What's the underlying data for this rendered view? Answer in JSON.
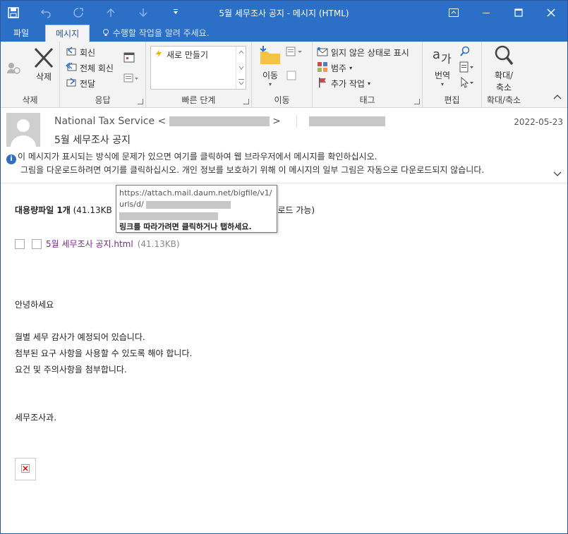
{
  "window": {
    "title": "5월 세무조사 공지 - 메시지 (HTML)"
  },
  "tabs": {
    "file": "파일",
    "message": "메시지",
    "tell_me": "수행할 작업을 알려 주세요."
  },
  "ribbon": {
    "delete_group": {
      "label": "삭제",
      "delete_button": "삭제"
    },
    "respond_group": {
      "label": "응답",
      "reply": "회신",
      "reply_all": "전체 회신",
      "forward": "전달"
    },
    "quick_steps_group": {
      "label": "빠른 단계",
      "new": "새로 만들기"
    },
    "move_group": {
      "label": "이동",
      "move_button": "이동"
    },
    "tags_group": {
      "label": "태그",
      "mark_unread": "읽지 않은 상태로 표시",
      "categorize": "범주",
      "follow_up": "추가 작업"
    },
    "editing_group": {
      "label": "편집",
      "translate": "번역"
    },
    "zoom_group": {
      "label": "확대/축소",
      "zoom": "확대/",
      "zoom2": "축소"
    }
  },
  "header": {
    "sender_name": "National Tax Service",
    "sender_open": "<",
    "sender_close": ">",
    "subject": "5월 세무조사 공지",
    "date": "2022-05-23",
    "info_line1": "이 메시지가 표시되는 방식에 문제가 있으면 여기를 클릭하여 웹 브라우저에서 메시지를 확인하십시오.",
    "info_line2": "그림을 다운로드하려면 여기를 클릭하십시오. 개인 정보를 보호하기 위해 이 메시지의 일부 그림은 자동으로 다운로드되지 않습니다."
  },
  "body": {
    "bigfile_label": "대용량파일 1개",
    "bigfile_info": "(41.13KB",
    "bigfile_suffix": "운로드 가능)",
    "attachment_name": "5월 세무조사 공지.html",
    "attachment_size": "(41.13KB)",
    "greeting": "안녕하세요",
    "line1": "월별 세무 감사가 예정되어 있습니다.",
    "line2": "첨부된 요구 사항을 사용할 수 있도록 해야 합니다.",
    "line3": "요건 및 주의사항을 첨부합니다.",
    "signature": "세무조사과."
  },
  "tooltip": {
    "url_line1": "https://attach.mail.daum.net/bigfile/v1/",
    "url_line2": "urls/d/",
    "hint": "링크를 따라가려면 클릭하거나 탭하세요."
  },
  "colors": {
    "accent": "#2b70c6",
    "link_visited": "#7a2a8a"
  }
}
